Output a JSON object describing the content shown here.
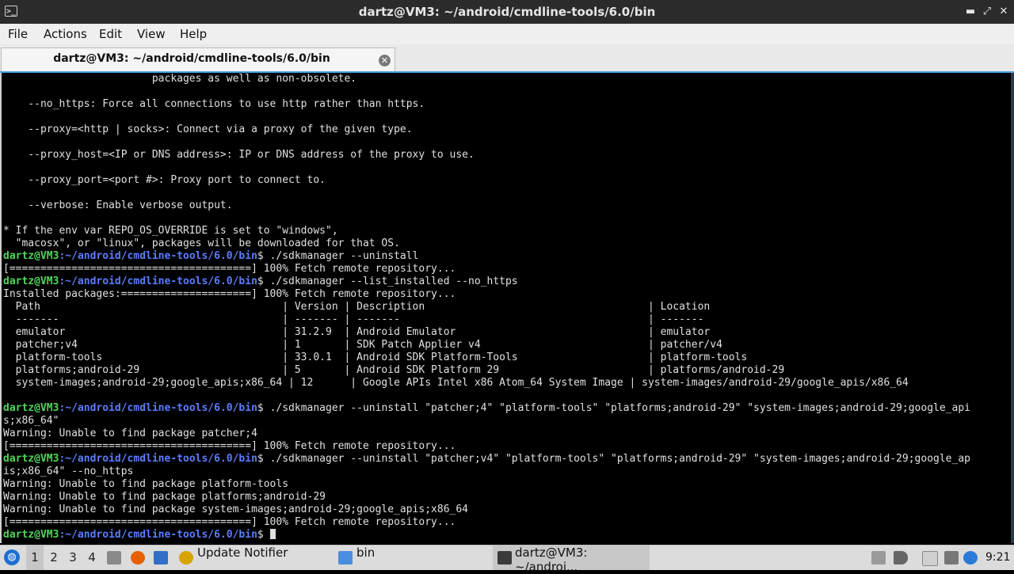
{
  "window": {
    "title": "dartz@VM3: ~/android/cmdline-tools/6.0/bin",
    "app_icon_glyph": ">_",
    "controls": {
      "minimize": "▬",
      "maximize": "⤢",
      "close": "✕"
    }
  },
  "menubar": {
    "file": "File",
    "actions": "Actions",
    "edit": "Edit",
    "view": "View",
    "help": "Help"
  },
  "tab": {
    "label": "dartz@VM3: ~/android/cmdline-tools/6.0/bin",
    "close_glyph": "✕"
  },
  "terminal": {
    "prompt_user": "dartz@VM3",
    "prompt_path": ":~/android/cmdline-tools/6.0/bin",
    "prompt_suffix": "$ ",
    "lines": [
      {
        "text": "                        packages as well as non-obsolete."
      },
      {
        "text": ""
      },
      {
        "text": "    --no_https: Force all connections to use http rather than https."
      },
      {
        "text": ""
      },
      {
        "text": "    --proxy=<http | socks>: Connect via a proxy of the given type."
      },
      {
        "text": ""
      },
      {
        "text": "    --proxy_host=<IP or DNS address>: IP or DNS address of the proxy to use."
      },
      {
        "text": ""
      },
      {
        "text": "    --proxy_port=<port #>: Proxy port to connect to."
      },
      {
        "text": ""
      },
      {
        "text": "    --verbose: Enable verbose output."
      },
      {
        "text": ""
      },
      {
        "text": "* If the env var REPO_OS_OVERRIDE is set to \"windows\","
      },
      {
        "text": "  \"macosx\", or \"linux\", packages will be downloaded for that OS."
      },
      {
        "prompt": true,
        "text": "./sdkmanager --uninstall"
      },
      {
        "text": "[=======================================] 100% Fetch remote repository..."
      },
      {
        "prompt": true,
        "text": "./sdkmanager --list_installed --no_https"
      },
      {
        "text": "Installed packages:=====================] 100% Fetch remote repository..."
      },
      {
        "text": "  Path                                       | Version | Description                                    | Location"
      },
      {
        "text": "  -------                                    | ------- | -------                                        | -------"
      },
      {
        "text": "  emulator                                   | 31.2.9  | Android Emulator                               | emulator"
      },
      {
        "text": "  patcher;v4                                 | 1       | SDK Patch Applier v4                           | patcher/v4"
      },
      {
        "text": "  platform-tools                             | 33.0.1  | Android SDK Platform-Tools                     | platform-tools"
      },
      {
        "text": "  platforms;android-29                       | 5       | Android SDK Platform 29                        | platforms/android-29"
      },
      {
        "text": "  system-images;android-29;google_apis;x86_64 | 12      | Google APIs Intel x86 Atom_64 System Image | system-images/android-29/google_apis/x86_64"
      },
      {
        "text": ""
      },
      {
        "prompt": true,
        "text": "./sdkmanager --uninstall \"patcher;4\" \"platform-tools\" \"platforms;android-29\" \"system-images;android-29;google_api"
      },
      {
        "text": "s;x86_64\""
      },
      {
        "text": "Warning: Unable to find package patcher;4"
      },
      {
        "text": "[=======================================] 100% Fetch remote repository..."
      },
      {
        "prompt": true,
        "text": "./sdkmanager --uninstall \"patcher;v4\" \"platform-tools\" \"platforms;android-29\" \"system-images;android-29;google_ap"
      },
      {
        "text": "is;x86_64\" --no_https"
      },
      {
        "text": "Warning: Unable to find package platform-tools"
      },
      {
        "text": "Warning: Unable to find package platforms;android-29"
      },
      {
        "text": "Warning: Unable to find package system-images;android-29;google_apis;x86_64"
      },
      {
        "text": "[=======================================] 100% Fetch remote repository..."
      },
      {
        "prompt": true,
        "text": "",
        "cursor": true
      }
    ]
  },
  "taskbar": {
    "start_glyph": "◍",
    "workspaces": [
      "1",
      "2",
      "3",
      "4"
    ],
    "active_workspace": "1",
    "tasks": {
      "update_notifier": "Update Notifier",
      "file_manager": "bin",
      "terminal": "dartz@VM3: ~/androi..."
    },
    "clock": "9:21",
    "colors": {
      "accent": "#4aa3df",
      "prompt_user": "#4fd65a",
      "prompt_path": "#5b7cff"
    }
  }
}
